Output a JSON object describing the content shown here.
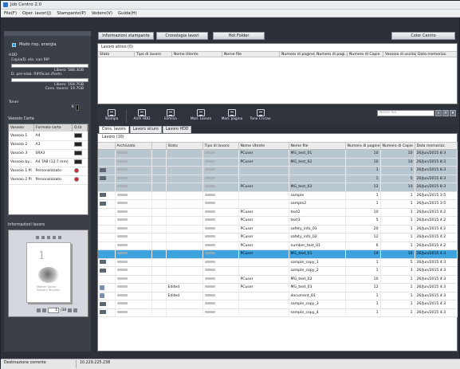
{
  "window": {
    "title": "Job Centro 2.0"
  },
  "menu": [
    "File(F)",
    "Oper. lavori(J)",
    "Stampante(P)",
    "Vedere(V)",
    "Guida(H)"
  ],
  "left": {
    "energy": "Modo risp. energia",
    "hdd_title": "HDD",
    "hdd1": "Copia/D. ela. con RIP",
    "hdd1_free": "Libero: 588.3GB",
    "hdd2": "D. pre-elab. RIP/Scan./Form.",
    "hdd2_free": "Libero: 164.7GB",
    "hdd2_jobs": "Cons. lavoro: 19.7GB",
    "toner": "Toner",
    "toner_k": "K",
    "tray_title": "Vassoio Carta",
    "tray_headers": [
      "Vassoio",
      "Formato carta",
      "Q.tà"
    ],
    "trays": [
      {
        "name": "Vassoio 1",
        "size": "A4",
        "swatch": "black"
      },
      {
        "name": "Vassoio 2",
        "size": "A3",
        "swatch": "black"
      },
      {
        "name": "Vassoio 3",
        "size": "SRA3",
        "swatch": "black"
      },
      {
        "name": "Vassoio by...",
        "size": "A4 TAB (12.7 mm)",
        "swatch": "black"
      },
      {
        "name": "Vassoio 1 PI",
        "size": "Personalizzato",
        "swatch": "red"
      },
      {
        "name": "Vassoio 2 PI",
        "size": "Personalizzato",
        "swatch": "red"
      }
    ],
    "info_title": "Informazioni lavoro",
    "preview_page": "1",
    "preview_caption1": "Mother Goose",
    "preview_caption2": "Nursery Rhymes",
    "page_current": "1",
    "page_total": "/38"
  },
  "top_buttons": [
    "Informazioni stampante",
    "Cronologia lavori",
    "Hot Folder",
    "Color Centro"
  ],
  "active": {
    "label": "Lavoro attivo (0)",
    "headers": [
      "Stato",
      "Tipo di lavoro",
      "Nome Utente",
      "Nome file",
      "Numero di pagine",
      "Numero di pagi...",
      "Numero di Copie",
      "Vassoio di uscita",
      "Data memorizz."
    ]
  },
  "toolbar": [
    "Stampa",
    "Arch HDD",
    "Elimina",
    "Mod. Lavoro",
    "Mod. pagina",
    "Tono Crv.lav."
  ],
  "search": {
    "placeholder": "Nome file"
  },
  "tabs": [
    "Cons. lavoro",
    "Lavoro sicuro",
    "Lavoro HDD"
  ],
  "main": {
    "label": "Lavoro (10)",
    "headers": [
      "",
      "Archiviato",
      "",
      "Stato",
      "Tipo di lavoro",
      "Nome Utente",
      "Nome file",
      "Numero di pagine",
      "Numero di Copie",
      "Data memorizz."
    ],
    "rows": [
      {
        "style": "grey",
        "icon": "",
        "user": "PCuser",
        "file": "MG_test_01",
        "pages": "10",
        "copies": "10",
        "date": "26/Jun/2015 8:3",
        "status": ""
      },
      {
        "style": "grey",
        "icon": "",
        "user": "PCuser",
        "file": "MG_test_02",
        "pages": "10",
        "copies": "10",
        "date": "26/Jun/2015 8:3",
        "status": ""
      },
      {
        "style": "grey",
        "icon": "ricon",
        "user": "",
        "file": "",
        "pages": "1",
        "copies": "1",
        "date": "26/Jun/2015 8:3",
        "status": ""
      },
      {
        "style": "grey",
        "icon": "ricon",
        "user": "",
        "file": "",
        "pages": "1",
        "copies": "5",
        "date": "26/Jun/2015 8:3",
        "status": ""
      },
      {
        "style": "grey",
        "icon": "",
        "user": "PCuser",
        "file": "MG_test_03",
        "pages": "12",
        "copies": "10",
        "date": "26/Jun/2015 8:3",
        "status": ""
      },
      {
        "style": "",
        "icon": "ricon",
        "user": "",
        "file": "sample",
        "pages": "1",
        "copies": "1",
        "date": "26/Jun/2015 3:5",
        "status": ""
      },
      {
        "style": "",
        "icon": "ricon",
        "user": "",
        "file": "sample2",
        "pages": "1",
        "copies": "1",
        "date": "26/Jun/2015 3:5",
        "status": ""
      },
      {
        "style": "",
        "icon": "",
        "user": "PCuser",
        "file": "text2",
        "pages": "10",
        "copies": "1",
        "date": "26/Jun/2015 4:2",
        "status": ""
      },
      {
        "style": "",
        "icon": "",
        "user": "PCuser",
        "file": "text3",
        "pages": "5",
        "copies": "1",
        "date": "26/Jun/2015 4:2",
        "status": ""
      },
      {
        "style": "",
        "icon": "",
        "user": "PCuser",
        "file": "safety_info_01",
        "pages": "20",
        "copies": "1",
        "date": "26/Jun/2015 4:2",
        "status": ""
      },
      {
        "style": "",
        "icon": "",
        "user": "PCuser",
        "file": "safety_info_02",
        "pages": "12",
        "copies": "1",
        "date": "26/Jun/2015 4:2",
        "status": ""
      },
      {
        "style": "",
        "icon": "",
        "user": "PCuser",
        "file": "number_text_01",
        "pages": "6",
        "copies": "1",
        "date": "26/Jun/2015 4:2",
        "status": ""
      },
      {
        "style": "sel",
        "icon": "",
        "user": "PCuser",
        "file": "MG_text_01",
        "pages": "10",
        "copies": "10",
        "date": "26/Jun/2015 4:3",
        "status": ""
      },
      {
        "style": "",
        "icon": "ricon",
        "user": "",
        "file": "sample_copy_1",
        "pages": "1",
        "copies": "5",
        "date": "26/Jun/2015 4:3",
        "status": ""
      },
      {
        "style": "",
        "icon": "ricon",
        "user": "",
        "file": "sample_copy_2",
        "pages": "1",
        "copies": "3",
        "date": "26/Jun/2015 4:3",
        "status": ""
      },
      {
        "style": "",
        "icon": "",
        "user": "PCuser",
        "file": "MG_text_02",
        "pages": "10",
        "copies": "1",
        "date": "26/Jun/2015 4:3",
        "status": ""
      },
      {
        "style": "",
        "icon": "paper",
        "user": "PCuser",
        "file": "MG_text_03",
        "pages": "12",
        "copies": "1",
        "date": "26/Jun/2015 4:3",
        "status": "Edited"
      },
      {
        "style": "",
        "icon": "paper",
        "user": "",
        "file": "document_01",
        "pages": "1",
        "copies": "1",
        "date": "26/Jun/2015 4:3",
        "status": "Edited"
      },
      {
        "style": "",
        "icon": "ricon",
        "user": "",
        "file": "sample_copy_3",
        "pages": "1",
        "copies": "1",
        "date": "26/Jun/2015 4:3",
        "status": ""
      },
      {
        "style": "",
        "icon": "ricon",
        "user": "",
        "file": "sample_copy_4",
        "pages": "1",
        "copies": "1",
        "date": "26/Jun/2015 4:3",
        "status": ""
      }
    ]
  },
  "status": {
    "left": "Destinazione corrente",
    "right": "10.229.225.238"
  }
}
